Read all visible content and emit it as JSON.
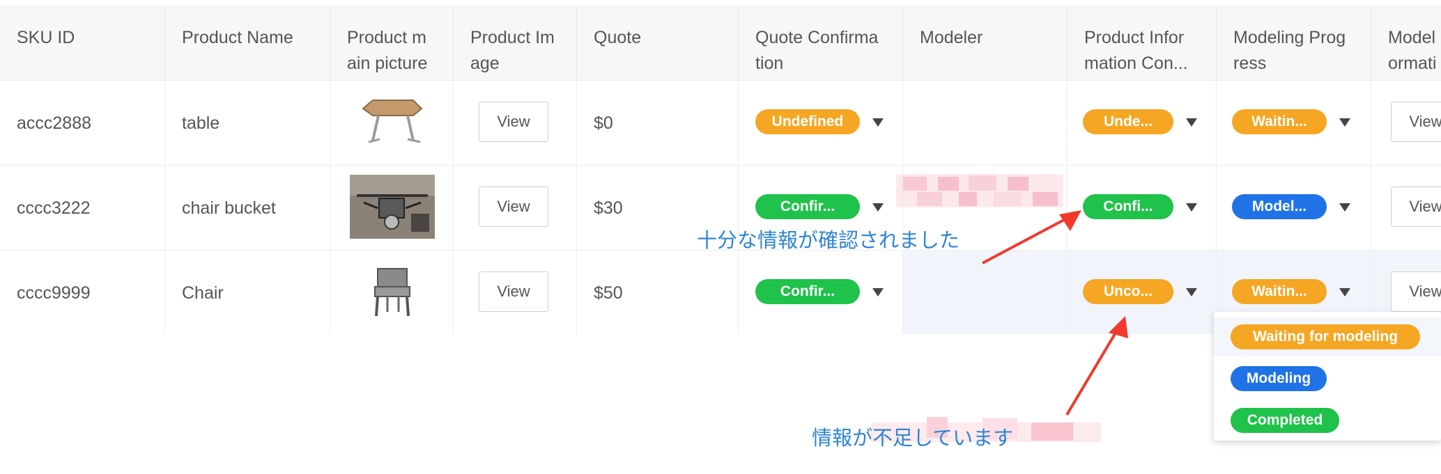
{
  "headers": [
    "SKU ID",
    "Product Name",
    "Product m\nain picture",
    "Product Im\nage",
    "Quote",
    "Quote Confirma\ntion",
    "Modeler",
    "Product Infor\nmation Con...",
    "Modeling Prog\nress",
    "Model\normati"
  ],
  "rows": [
    {
      "sku": "accc2888",
      "name": "table",
      "view": "View",
      "quote": "$0",
      "quote_confirm": "Undefined",
      "product_info": "Unde...",
      "modeling": "Waitin...",
      "model_view": "View"
    },
    {
      "sku": "cccc3222",
      "name": "chair bucket",
      "view": "View",
      "quote": "$30",
      "quote_confirm": "Confir...",
      "product_info": "Confi...",
      "modeling": "Model...",
      "model_view": "View"
    },
    {
      "sku": "cccc9999",
      "name": "Chair",
      "view": "View",
      "quote": "$50",
      "quote_confirm": "Confir...",
      "product_info": "Unco...",
      "modeling": "Waitin...",
      "model_view": "View"
    }
  ],
  "dropdown_options": [
    "Waiting for modeling",
    "Modeling",
    "Completed"
  ],
  "annotations": {
    "sufficient": "十分な情報が確認されました",
    "insufficient": "情報が不足しています"
  },
  "colors": {
    "orange": "#f5a623",
    "green": "#1fc24a",
    "blue": "#1f73e6",
    "annotation_text": "#2e84d6",
    "arrow": "#f03a2e"
  }
}
